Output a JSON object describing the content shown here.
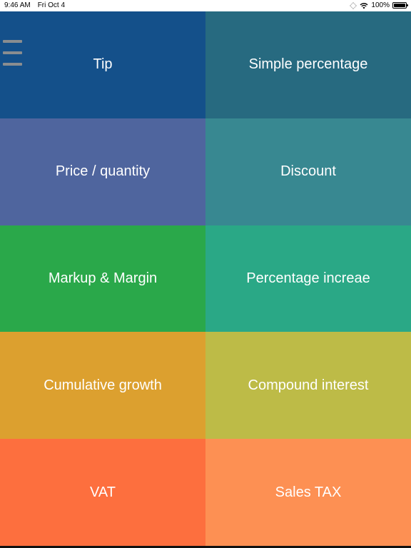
{
  "status_bar": {
    "time": "9:46 AM",
    "date": "Fri Oct 4",
    "battery": "100%"
  },
  "tiles": [
    {
      "label": "Tip",
      "color": "#14508a"
    },
    {
      "label": "Simple percentage",
      "color": "#276a80"
    },
    {
      "label": "Price / quantity",
      "color": "#4f659e"
    },
    {
      "label": "Discount",
      "color": "#388891"
    },
    {
      "label": "Markup & Margin",
      "color": "#2aa84a"
    },
    {
      "label": "Percentage increae",
      "color": "#2aa886"
    },
    {
      "label": "Cumulative growth",
      "color": "#dca02f"
    },
    {
      "label": "Compound interest",
      "color": "#bdbb47"
    },
    {
      "label": "VAT",
      "color": "#fd6f3e"
    },
    {
      "label": "Sales TAX",
      "color": "#fd9053"
    }
  ],
  "menu": {
    "icon": "hamburger-menu-icon",
    "color": "#8a8d90"
  }
}
